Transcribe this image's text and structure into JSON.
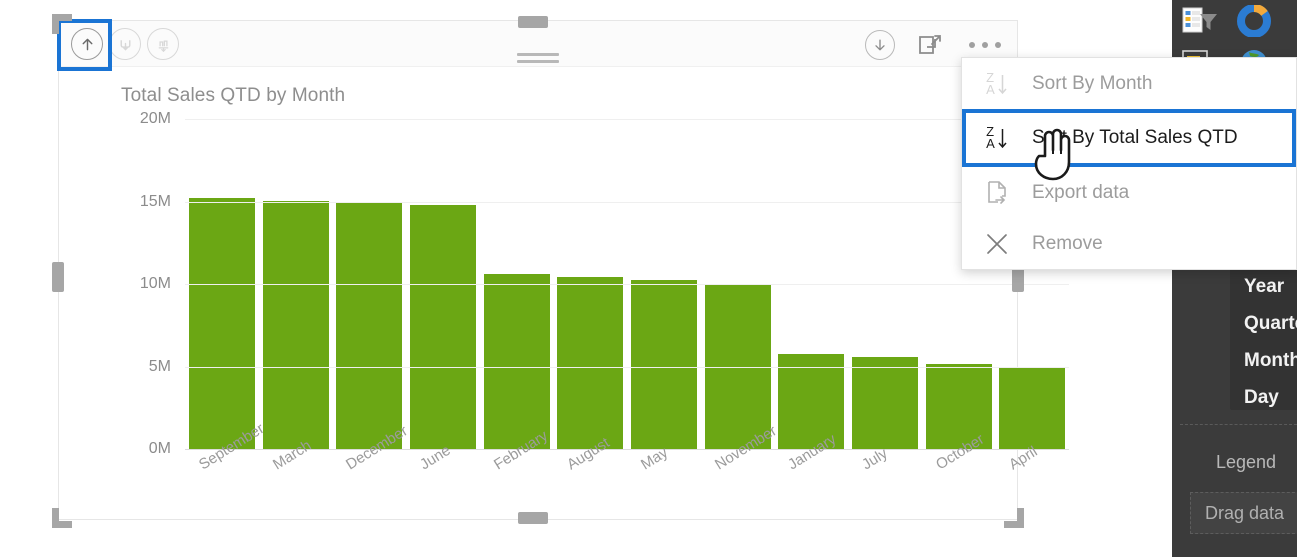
{
  "visual": {
    "title": "Total Sales QTD by Month",
    "header_icons_left": [
      {
        "name": "sort-ascending-icon",
        "state": "active"
      },
      {
        "name": "sort-alternate-icon",
        "state": "dim"
      },
      {
        "name": "sort-axis-icon",
        "state": "dim"
      }
    ],
    "header_icons_right": [
      {
        "name": "drill-down-icon"
      },
      {
        "name": "focus-mode-icon"
      },
      {
        "name": "more-options-icon"
      }
    ]
  },
  "context_menu": {
    "items": [
      {
        "label": "Sort By Month",
        "icon": "sort-za-icon",
        "enabled": false,
        "highlighted": false
      },
      {
        "label": "Sort By Total Sales QTD",
        "icon": "sort-za-icon",
        "enabled": true,
        "highlighted": true
      },
      {
        "label": "Export data",
        "icon": "export-data-icon",
        "enabled": false,
        "highlighted": false
      },
      {
        "label": "Remove",
        "icon": "close-x-icon",
        "enabled": false,
        "highlighted": false
      }
    ]
  },
  "right_panel": {
    "gallery_icons": [
      "table-filter-icon",
      "donut-chart-icon",
      "card-matrix-icon",
      "map-globe-icon"
    ],
    "hierarchy": [
      "Year",
      "Quarter",
      "Month",
      "Day"
    ],
    "legend_label": "Legend",
    "drop_zone_placeholder": "Drag data"
  },
  "colors": {
    "bar": "#6BA714",
    "selection_blue": "#1a74d4",
    "panel_bg": "#3b3b3b",
    "axis_text": "#8c8c8c"
  },
  "chart_data": {
    "type": "bar",
    "title": "Total Sales QTD by Month",
    "xlabel": "",
    "ylabel": "",
    "ylim": [
      0,
      20000000
    ],
    "ytick_labels": [
      "0M",
      "5M",
      "10M",
      "15M",
      "20M"
    ],
    "ytick_values": [
      0,
      5000000,
      10000000,
      15000000,
      20000000
    ],
    "grid": true,
    "legend": "none",
    "categories": [
      "September",
      "March",
      "December",
      "June",
      "February",
      "August",
      "May",
      "November",
      "January",
      "July",
      "October",
      "April"
    ],
    "values": [
      15200000,
      15050000,
      14900000,
      14800000,
      10600000,
      10400000,
      10250000,
      10000000,
      5750000,
      5600000,
      5150000,
      5000000
    ],
    "series": [
      {
        "name": "Total Sales QTD",
        "values": [
          15200000,
          15050000,
          14900000,
          14800000,
          10600000,
          10400000,
          10250000,
          10000000,
          5750000,
          5600000,
          5150000,
          5000000
        ]
      }
    ]
  }
}
